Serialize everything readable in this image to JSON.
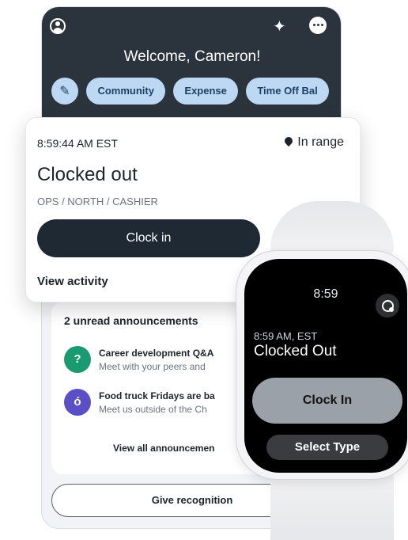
{
  "phone": {
    "welcome": "Welcome, Cameron!",
    "chips": [
      "Community",
      "Expense",
      "Time Off Bal"
    ],
    "pencil_icon": "pencil-icon",
    "announcements": {
      "title": "2 unread announcements",
      "items": [
        {
          "title": "Career development Q&A",
          "subtitle": "Meet with your peers and",
          "icon": "chat-question-icon",
          "icon_color": "#1a9b6f",
          "glyph": "?"
        },
        {
          "title": "Food truck Fridays are ba",
          "subtitle": "Meet us outside of the Ch",
          "icon": "food-icon",
          "icon_color": "#5a4fc4",
          "glyph": "ó"
        }
      ],
      "view_all": "View all announcemen"
    },
    "recognition": "Give recognition"
  },
  "card": {
    "time": "8:59:44 AM EST",
    "range": "In range",
    "status": "Clocked out",
    "path": "OPS / NORTH / CASHIER",
    "clock_in": "Clock in",
    "activity": "View activity"
  },
  "watch": {
    "time": "8:59",
    "subtitle": "8:59 AM, EST",
    "status": "Clocked Out",
    "clock_in": "Clock In",
    "select": "Select Type"
  },
  "colors": {
    "header": "#2b333d",
    "chip": "#bdd8f2",
    "button_dark": "#1f2933"
  }
}
